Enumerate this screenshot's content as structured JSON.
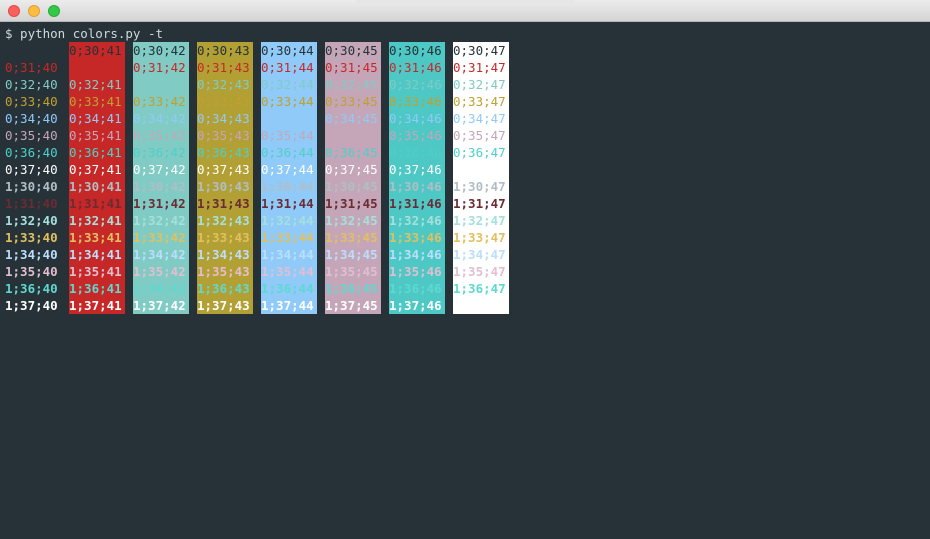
{
  "terminal": {
    "command": "$ python colors.py -t"
  },
  "palette": {
    "fg": {
      "30": "#263238",
      "31": "#c62828",
      "32": "#80cbc4",
      "33": "#c0a030",
      "34": "#90caf9",
      "35": "#c5a6b8",
      "36": "#4dd0c8",
      "37": "#ffffff"
    },
    "fg_bold": {
      "30": "#b0bec5",
      "31": "#6b2b33",
      "32": "#a6e0da",
      "33": "#e0c060",
      "34": "#bbdefb",
      "35": "#e1bfd0",
      "36": "#5fd8d0",
      "37": "#ffffff"
    },
    "bg": {
      "40": "#263238",
      "41": "#c62828",
      "42": "#80cbc4",
      "43": "#b2a034",
      "44": "#90caf9",
      "45": "#c5a6b8",
      "46": "#4dc8c4",
      "47": "#ffffff"
    }
  },
  "grid": {
    "rows": [
      {
        "attr": "0",
        "fg": "30"
      },
      {
        "attr": "0",
        "fg": "31"
      },
      {
        "attr": "0",
        "fg": "32"
      },
      {
        "attr": "0",
        "fg": "33"
      },
      {
        "attr": "0",
        "fg": "34"
      },
      {
        "attr": "0",
        "fg": "35"
      },
      {
        "attr": "0",
        "fg": "36"
      },
      {
        "attr": "0",
        "fg": "37"
      },
      {
        "attr": "1",
        "fg": "30"
      },
      {
        "attr": "1",
        "fg": "31"
      },
      {
        "attr": "1",
        "fg": "32"
      },
      {
        "attr": "1",
        "fg": "33"
      },
      {
        "attr": "1",
        "fg": "34"
      },
      {
        "attr": "1",
        "fg": "35"
      },
      {
        "attr": "1",
        "fg": "36"
      },
      {
        "attr": "1",
        "fg": "37"
      }
    ],
    "columns": [
      "40",
      "41",
      "42",
      "43",
      "44",
      "45",
      "46",
      "47"
    ]
  }
}
